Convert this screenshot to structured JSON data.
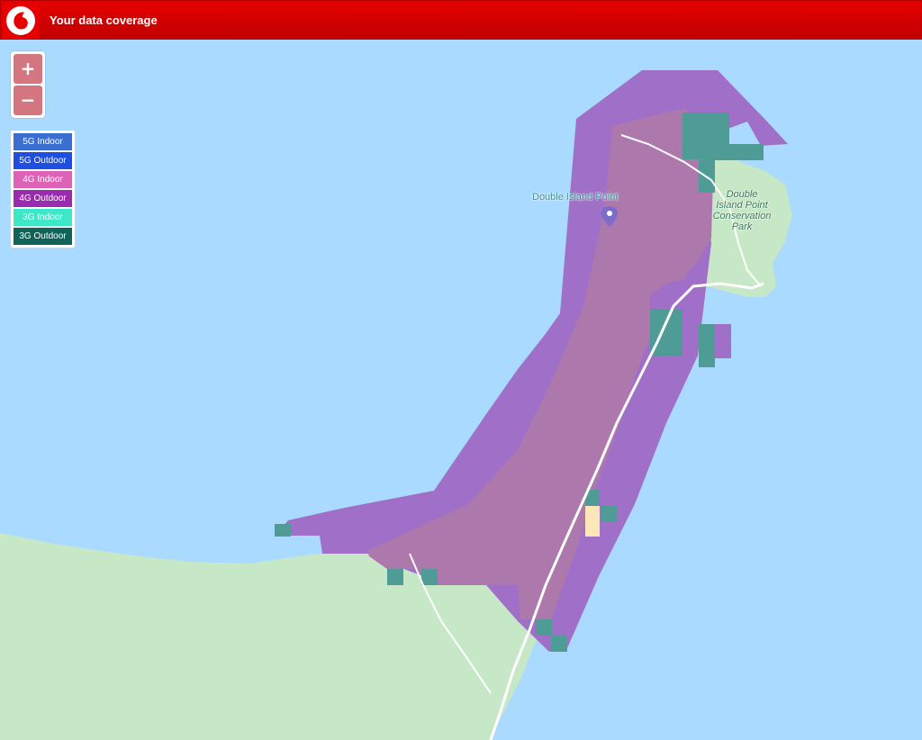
{
  "header": {
    "title": "Your data coverage",
    "brand_color": "#e60000"
  },
  "zoom": {
    "in_label": "+",
    "out_label": "−"
  },
  "legend": {
    "items": [
      {
        "label": "5G Indoor",
        "color": "#3a6fd1"
      },
      {
        "label": "5G Outdoor",
        "color": "#1f4fe0"
      },
      {
        "label": "4G Indoor",
        "color": "#de62b5"
      },
      {
        "label": "4G Outdoor",
        "color": "#9a2aae"
      },
      {
        "label": "3G Indoor",
        "color": "#3de8c8"
      },
      {
        "label": "3G Outdoor",
        "color": "#0f6358"
      }
    ]
  },
  "map": {
    "water_color": "#aadaff",
    "land_color": "#c6e8c6",
    "coverage_4g_outdoor_color": "#a070c8",
    "coverage_4g_indoor_color": "#ad79ad",
    "coverage_3g_color": "#4f9c96",
    "poi_label": "Double Island Point",
    "poi_icon": "map-pin-icon",
    "park_label_lines": [
      "Double",
      "Island Point",
      "Conservation",
      "Park"
    ]
  }
}
